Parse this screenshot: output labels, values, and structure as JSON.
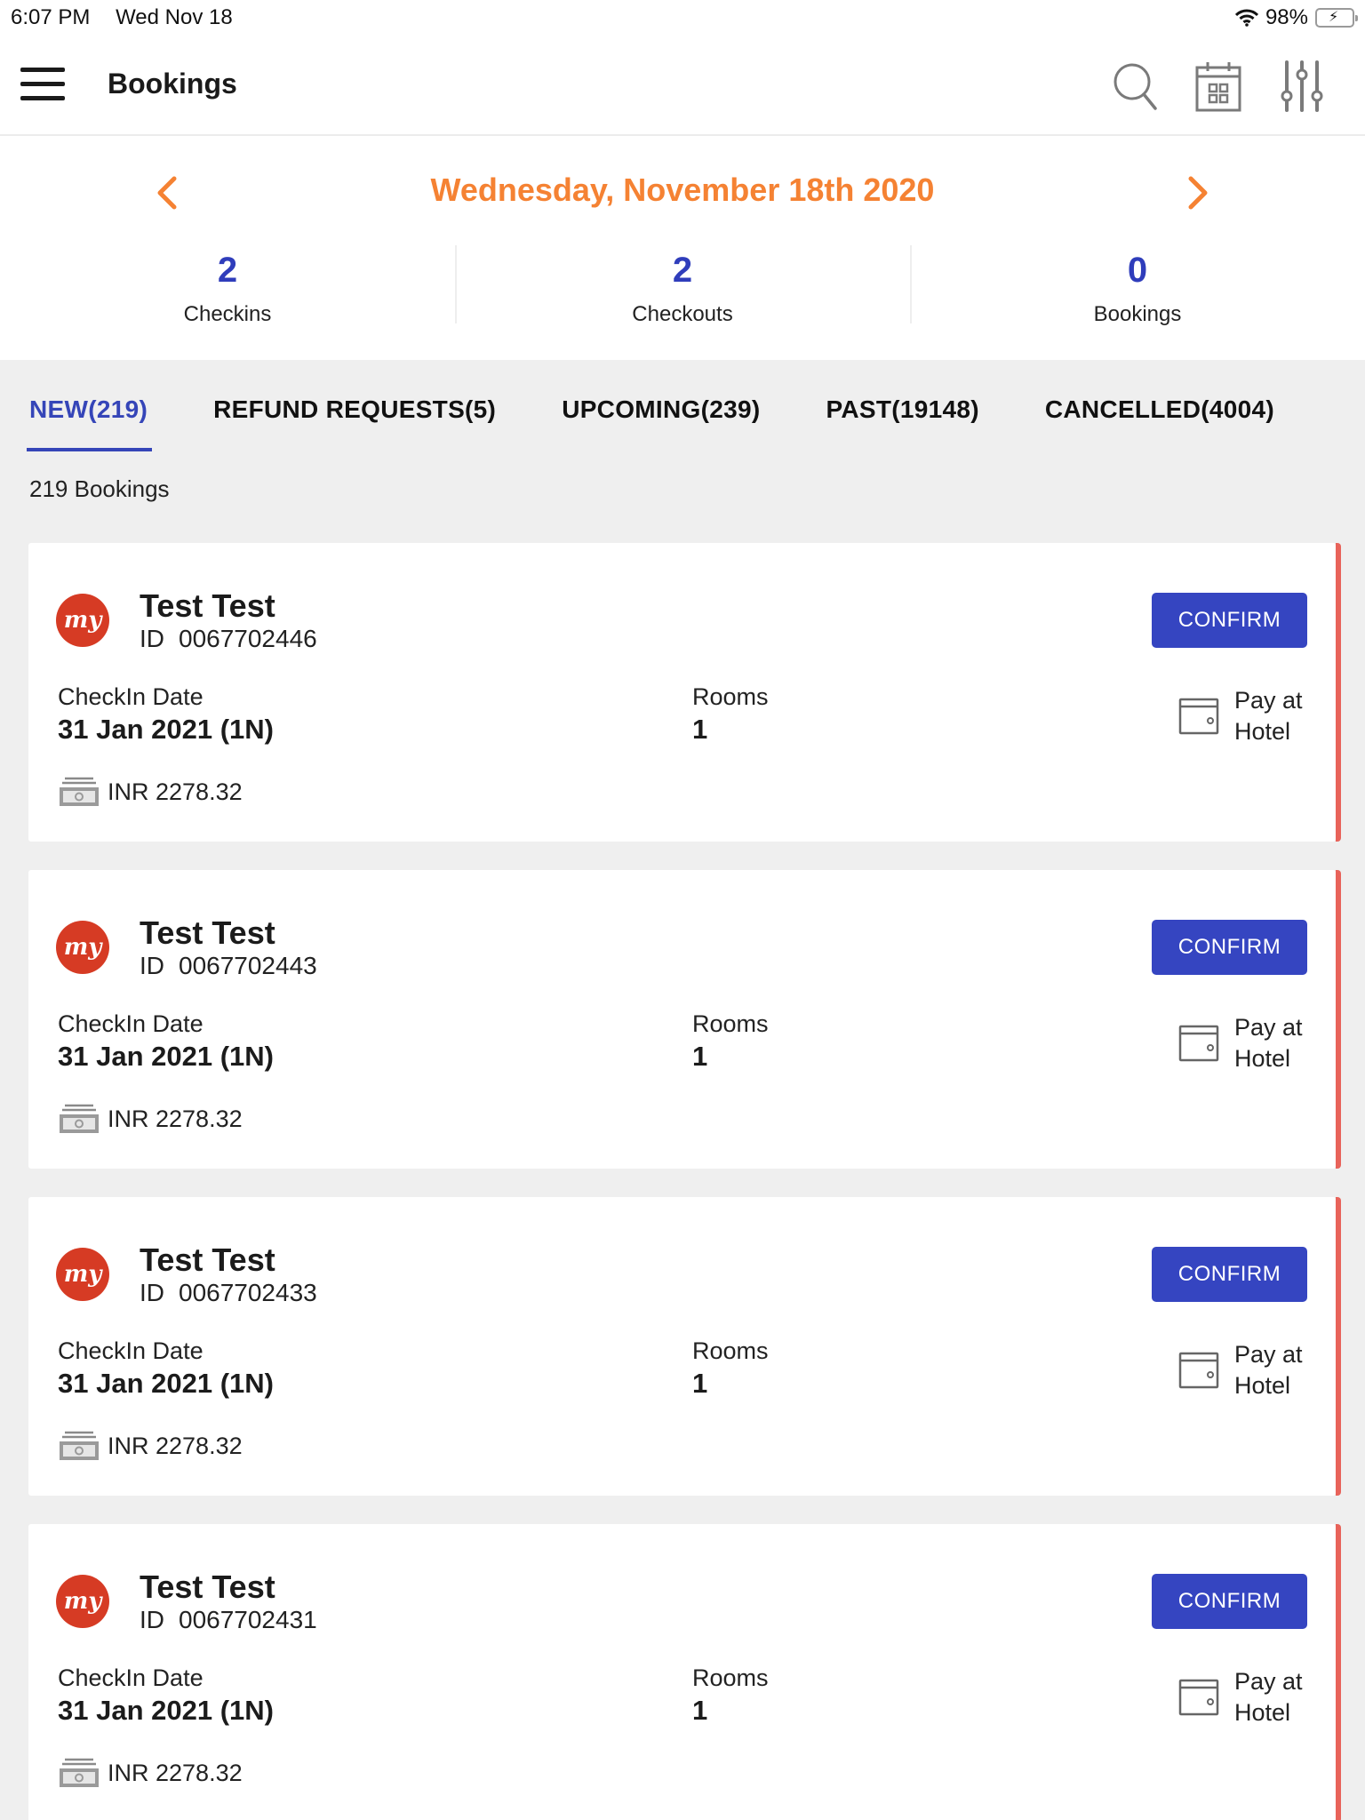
{
  "status_bar": {
    "time": "6:07 PM",
    "date": "Wed Nov 18",
    "battery": "98%"
  },
  "app_bar": {
    "title": "Bookings",
    "icons": [
      "menu-icon",
      "search-icon",
      "calendar-icon",
      "filter-sliders-icon"
    ]
  },
  "date_nav": {
    "current_date": "Wednesday, November 18th 2020",
    "prev_icon": "chevron-left-icon",
    "next_icon": "chevron-right-icon",
    "accent_color": "#F58233"
  },
  "summary": [
    {
      "value": "2",
      "label": "Checkins"
    },
    {
      "value": "2",
      "label": "Checkouts"
    },
    {
      "value": "0",
      "label": "Bookings"
    }
  ],
  "tabs": [
    {
      "label": "NEW(219)",
      "active": true
    },
    {
      "label": "REFUND REQUESTS(5)",
      "active": false
    },
    {
      "label": "UPCOMING(239)",
      "active": false
    },
    {
      "label": "PAST(19148)",
      "active": false
    },
    {
      "label": "CANCELLED(4004)",
      "active": false
    }
  ],
  "bookings_count_text": "219 Bookings",
  "card_labels": {
    "id_label": "ID",
    "checkin_label": "CheckIn Date",
    "rooms_label": "Rooms",
    "confirm_label": "CONFIRM"
  },
  "bookings": [
    {
      "guest": "Test Test",
      "id": "0067702446",
      "checkin": "31 Jan 2021 (1N)",
      "rooms": "1",
      "amount": "INR 2278.32",
      "payment": "Pay at Hotel"
    },
    {
      "guest": "Test Test",
      "id": "0067702443",
      "checkin": "31 Jan 2021 (1N)",
      "rooms": "1",
      "amount": "INR 2278.32",
      "payment": "Pay at Hotel"
    },
    {
      "guest": "Test Test",
      "id": "0067702433",
      "checkin": "31 Jan 2021 (1N)",
      "rooms": "1",
      "amount": "INR 2278.32",
      "payment": "Pay at Hotel"
    },
    {
      "guest": "Test Test",
      "id": "0067702431",
      "checkin": "31 Jan 2021 (1N)",
      "rooms": "1",
      "amount": "INR 2278.32",
      "payment": "Pay at Hotel"
    }
  ],
  "colors": {
    "primary": "#3545C1",
    "accent_orange": "#F58233",
    "stat_blue": "#2F3DBB",
    "card_stripe": "#E8635A",
    "logo_red": "#D63B24"
  }
}
